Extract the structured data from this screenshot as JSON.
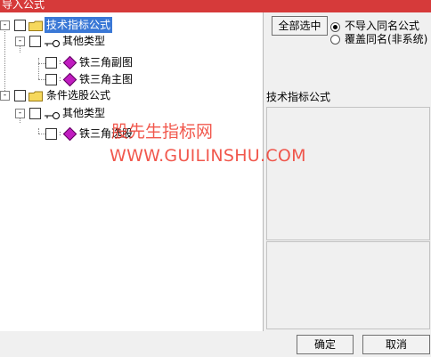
{
  "window": {
    "title": "导入公式"
  },
  "tree": {
    "nodes": [
      {
        "label": "技术指标公式",
        "expander": "-",
        "selected": true
      },
      {
        "label": "其他类型",
        "expander": "-"
      },
      {
        "label": "铁三角副图"
      },
      {
        "label": "铁三角主图"
      },
      {
        "label": "条件选股公式",
        "expander": "-"
      },
      {
        "label": "其他类型",
        "expander": "-"
      },
      {
        "label": "铁三角选股"
      }
    ]
  },
  "options": {
    "select_all_label": "全部选中",
    "no_import_same_name": "不导入同名公式",
    "overwrite_same_name": "覆盖同名(非系统)",
    "selected_option": "no_import_same_name"
  },
  "info_panel": {
    "label": "技术指标公式"
  },
  "watermark": {
    "line1": "股先生指标网",
    "line2": "WWW.GUILINSHU.COM"
  },
  "footer": {
    "ok_label": "确定",
    "cancel_label": "取消"
  },
  "colors": {
    "title_bar": "#d63a3a",
    "selection": "#3a78d6",
    "watermark": "#ef3b2f",
    "formula_icon": "#c01cc0"
  }
}
